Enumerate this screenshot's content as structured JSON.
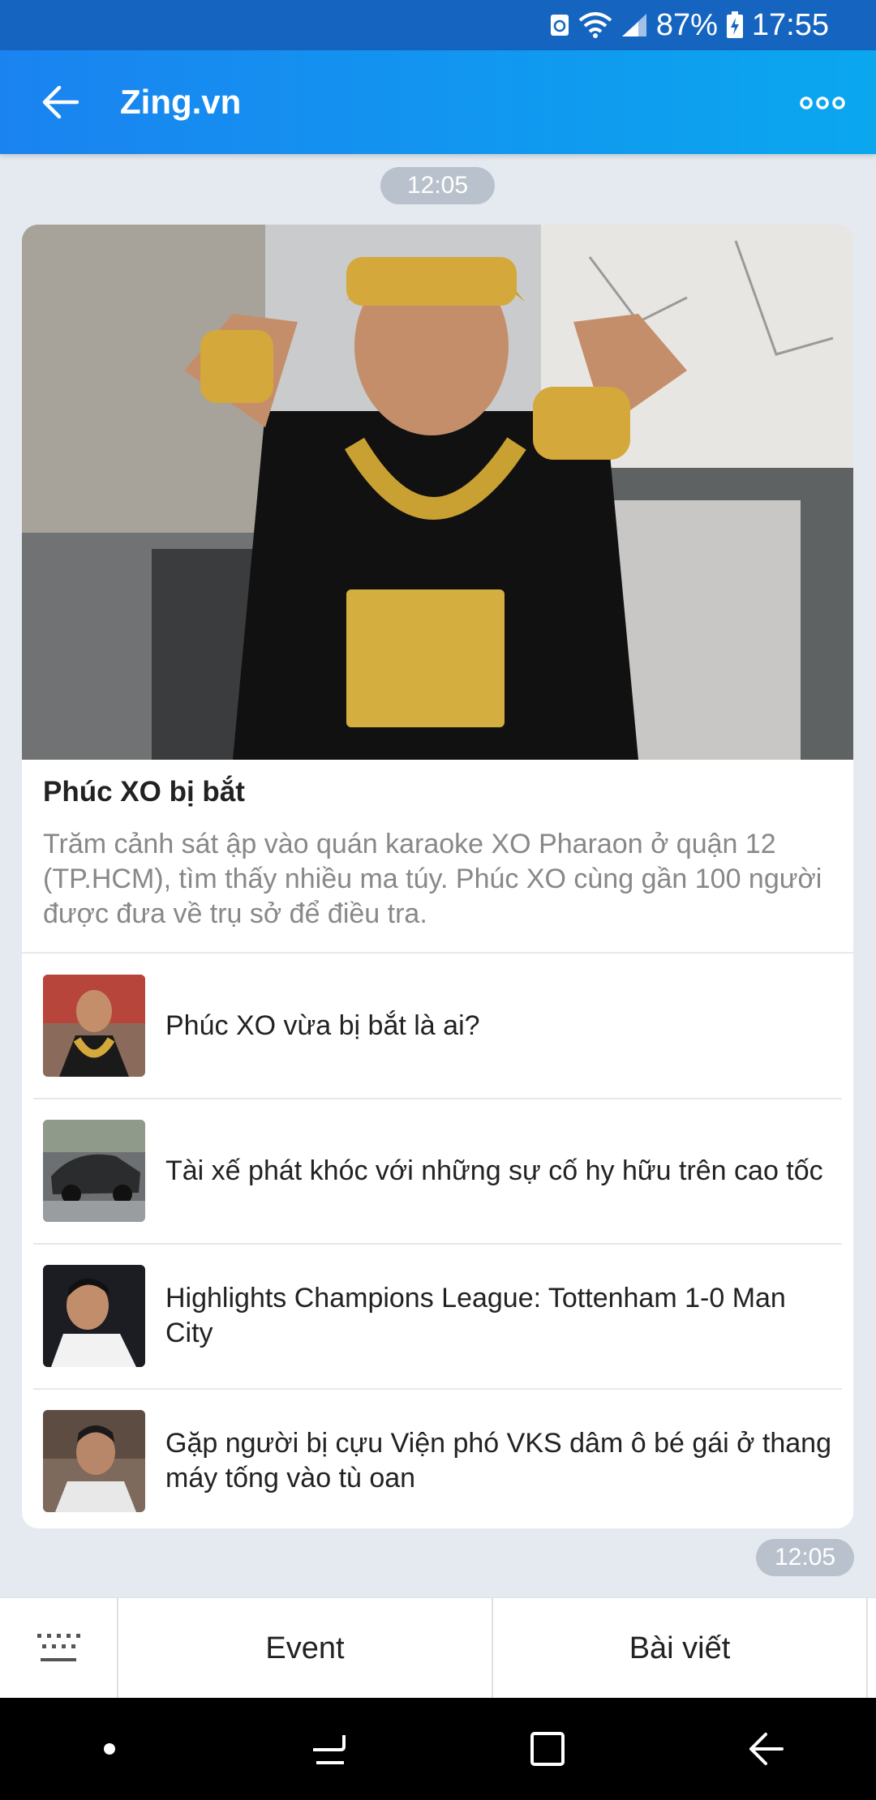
{
  "status_bar": {
    "battery": "87%",
    "time": "17:55",
    "icons": [
      "sync-icon",
      "wifi-icon",
      "signal-icon",
      "battery-charging-icon"
    ]
  },
  "header": {
    "title": "Zing.vn",
    "back_icon": "arrow-left-icon",
    "more_icon": "more-dots-icon"
  },
  "chat": {
    "time_top": "12:05",
    "time_bottom": "12:05",
    "card": {
      "title": "Phúc XO bị bắt",
      "description": "Trăm cảnh sát ập vào quán karaoke XO Pharaon ở quận 12 (TP.HCM), tìm thấy nhiều ma túy. Phúc XO cùng gần 100 người được đưa về trụ sở để điều tra.",
      "items": [
        {
          "text": "Phúc XO vừa bị bắt là ai?"
        },
        {
          "text": "Tài xế phát khóc với những sự cố hy hữu trên cao tốc"
        },
        {
          "text": "Highlights Champions League: Tottenham 1-0 Man City"
        },
        {
          "text": "Gặp người bị cựu Viện phó VKS dâm ô bé gái ở thang máy tống vào tù oan"
        }
      ]
    }
  },
  "bottom_menu": {
    "keyboard_icon": "keyboard-icon",
    "buttons": [
      "Event",
      "Bài viết"
    ]
  },
  "nav_bar": {
    "icons": [
      "dot-icon",
      "recent-apps-icon",
      "home-icon",
      "back-icon"
    ]
  },
  "colors": {
    "header_start": "#1a83f0",
    "header_end": "#0aa7ef",
    "status_bar": "#1565c0",
    "chat_bg": "#e5eaf1",
    "time_pill": "#b9c2cc"
  }
}
